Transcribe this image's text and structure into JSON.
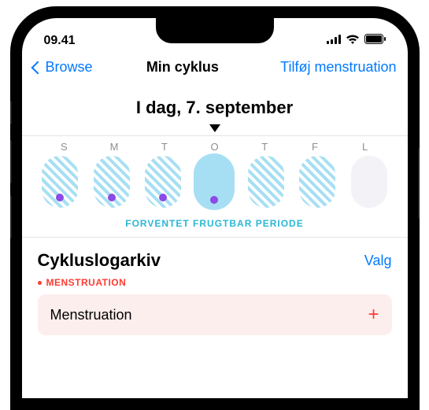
{
  "status": {
    "time": "09.41"
  },
  "nav": {
    "back": "Browse",
    "title": "Min cyklus",
    "action": "Tilføj menstruation"
  },
  "date_header": "I dag, 7. september",
  "week": {
    "days": [
      "S",
      "M",
      "T",
      "O",
      "T",
      "F",
      "L"
    ],
    "ovals": [
      {
        "hatched": true,
        "dot": true,
        "current": false,
        "faint": false
      },
      {
        "hatched": true,
        "dot": true,
        "current": false,
        "faint": false
      },
      {
        "hatched": true,
        "dot": true,
        "current": false,
        "faint": false
      },
      {
        "hatched": false,
        "dot": true,
        "current": true,
        "faint": false
      },
      {
        "hatched": true,
        "dot": false,
        "current": false,
        "faint": false
      },
      {
        "hatched": true,
        "dot": false,
        "current": false,
        "faint": false
      },
      {
        "hatched": false,
        "dot": false,
        "current": false,
        "faint": true
      }
    ],
    "caption": "FORVENTET FRUGTBAR PERIODE"
  },
  "cycle_log": {
    "title": "Cykluslogarkiv",
    "action": "Valg",
    "tag": "MENSTRUATION",
    "row_label": "Menstruation"
  }
}
